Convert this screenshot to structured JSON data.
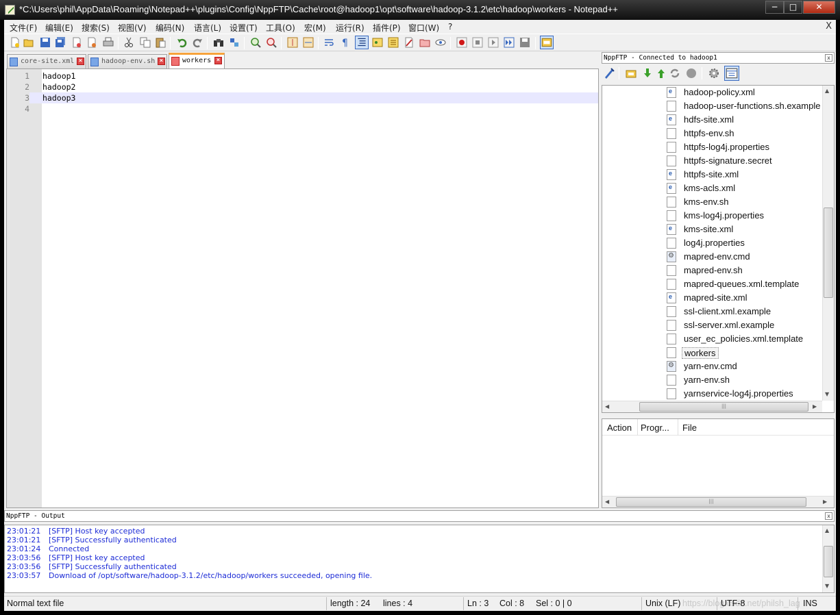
{
  "window": {
    "title": "*C:\\Users\\phil\\AppData\\Roaming\\Notepad++\\plugins\\Config\\NppFTP\\Cache\\root@hadoop1\\opt\\software\\hadoop-3.1.2\\etc\\hadoop\\workers - Notepad++",
    "min_label": "−",
    "max_label": "□",
    "close_label": "✕"
  },
  "menu": {
    "items": [
      "文件(F)",
      "编辑(E)",
      "搜索(S)",
      "视图(V)",
      "编码(N)",
      "语言(L)",
      "设置(T)",
      "工具(O)",
      "宏(M)",
      "运行(R)",
      "插件(P)",
      "窗口(W)",
      "?"
    ],
    "close_label": "X"
  },
  "toolbar": {
    "icons": [
      "new-file-icon",
      "open-file-icon",
      "save-icon",
      "save-all-icon",
      "close-icon",
      "close-all-icon",
      "print-icon",
      "cut-icon",
      "copy-icon",
      "paste-icon",
      "undo-icon",
      "redo-icon",
      "find-icon",
      "replace-icon",
      "zoom-in-icon",
      "zoom-out-icon",
      "sync-vertical-icon",
      "sync-horizontal-icon",
      "word-wrap-icon",
      "show-all-chars-icon",
      "indent-guide-icon",
      "doc-map-icon",
      "function-list-icon",
      "folder-workspace-icon",
      "monitor-icon",
      "record-macro-icon",
      "stop-record-icon",
      "play-macro-icon",
      "run-macro-multiple-icon",
      "save-macro-icon",
      "nppftp-show-icon"
    ]
  },
  "tabs": [
    {
      "label": "core-site.xml",
      "active": false
    },
    {
      "label": "hadoop-env.sh",
      "active": false
    },
    {
      "label": "workers",
      "active": true
    }
  ],
  "editor": {
    "lines": [
      {
        "num": "1",
        "text": "hadoop1"
      },
      {
        "num": "2",
        "text": "hadoop2"
      },
      {
        "num": "3",
        "text": "hadoop3"
      },
      {
        "num": "4",
        "text": ""
      }
    ],
    "current_line": 3
  },
  "ftp": {
    "caption": "NppFTP - Connected to hadoop1",
    "close_label": "x",
    "toolbar_icons": [
      "connect-icon",
      "download-folder-icon",
      "download-icon",
      "upload-icon",
      "refresh-icon",
      "abort-icon",
      "settings-icon",
      "message-window-icon"
    ],
    "files": [
      {
        "name": "hadoop-policy.xml",
        "type": "xml"
      },
      {
        "name": "hadoop-user-functions.sh.example",
        "type": "file"
      },
      {
        "name": "hdfs-site.xml",
        "type": "xml"
      },
      {
        "name": "httpfs-env.sh",
        "type": "file"
      },
      {
        "name": "httpfs-log4j.properties",
        "type": "file"
      },
      {
        "name": "httpfs-signature.secret",
        "type": "file"
      },
      {
        "name": "httpfs-site.xml",
        "type": "xml"
      },
      {
        "name": "kms-acls.xml",
        "type": "xml"
      },
      {
        "name": "kms-env.sh",
        "type": "file"
      },
      {
        "name": "kms-log4j.properties",
        "type": "file"
      },
      {
        "name": "kms-site.xml",
        "type": "xml"
      },
      {
        "name": "log4j.properties",
        "type": "file"
      },
      {
        "name": "mapred-env.cmd",
        "type": "cmd"
      },
      {
        "name": "mapred-env.sh",
        "type": "file"
      },
      {
        "name": "mapred-queues.xml.template",
        "type": "file"
      },
      {
        "name": "mapred-site.xml",
        "type": "xml"
      },
      {
        "name": "ssl-client.xml.example",
        "type": "file"
      },
      {
        "name": "ssl-server.xml.example",
        "type": "file"
      },
      {
        "name": "user_ec_policies.xml.template",
        "type": "file"
      },
      {
        "name": "workers",
        "type": "file",
        "selected": true
      },
      {
        "name": "yarn-env.cmd",
        "type": "cmd"
      },
      {
        "name": "yarn-env.sh",
        "type": "file"
      },
      {
        "name": "yarnservice-log4j.properties",
        "type": "file"
      }
    ],
    "queue_columns": [
      "Action",
      "Progr...",
      "File"
    ]
  },
  "output": {
    "caption": "NppFTP - Output",
    "close_label": "x",
    "lines": [
      {
        "time": "23:01:21",
        "text": "[SFTP] Host key accepted"
      },
      {
        "time": "23:01:21",
        "text": "[SFTP] Successfully authenticated"
      },
      {
        "time": "23:01:24",
        "text": "Connected"
      },
      {
        "time": "23:03:56",
        "text": "[SFTP] Host key accepted"
      },
      {
        "time": "23:03:56",
        "text": "[SFTP] Successfully authenticated"
      },
      {
        "time": "23:03:57",
        "text": "Download of /opt/software/hadoop-3.1.2/etc/hadoop/workers succeeded, opening file."
      }
    ]
  },
  "status": {
    "file_type": "Normal text file",
    "length": "length : 24",
    "lines": "lines : 4",
    "ln": "Ln : 3",
    "col": "Col : 8",
    "sel": "Sel : 0 | 0",
    "eol": "Unix (LF)",
    "encoding": "UTF-8",
    "mode": "INS",
    "watermark": "https://blog.csdn.net/philsh_lag"
  }
}
